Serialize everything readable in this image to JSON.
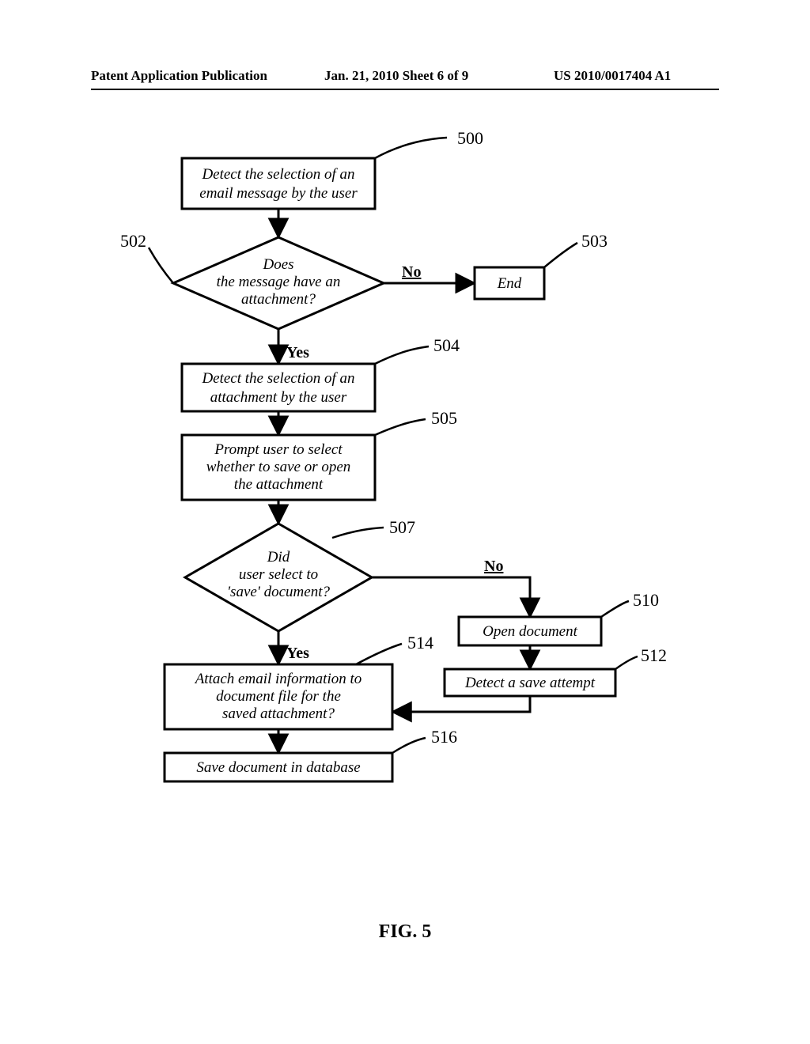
{
  "header": {
    "left": "Patent Application Publication",
    "center": "Jan. 21, 2010   Sheet 6 of 9",
    "right": "US 2010/0017404 A1"
  },
  "figure_label": "FIG. 5",
  "refs": {
    "n500": "500",
    "n502": "502",
    "n503": "503",
    "n504": "504",
    "n505": "505",
    "n507": "507",
    "n510": "510",
    "n512": "512",
    "n514": "514",
    "n516": "516"
  },
  "nodes": {
    "b500_l1": "Detect the selection of an",
    "b500_l2": "email message by the user",
    "d502_l1": "Does",
    "d502_l2": "the message have an",
    "d502_l3": "attachment?",
    "b503": "End",
    "b504_l1": "Detect the selection of an",
    "b504_l2": "attachment by the user",
    "b505_l1": "Prompt user to select",
    "b505_l2": "whether to save or open",
    "b505_l3": "the attachment",
    "d507_l1": "Did",
    "d507_l2": "user select to",
    "d507_l3": "'save' document?",
    "b510": "Open document",
    "b512": "Detect a save attempt",
    "b514_l1": "Attach email information to",
    "b514_l2": "document file for the",
    "b514_l3": "saved attachment?",
    "b516": "Save document in database"
  },
  "branches": {
    "no": "No",
    "yes": "Yes"
  }
}
